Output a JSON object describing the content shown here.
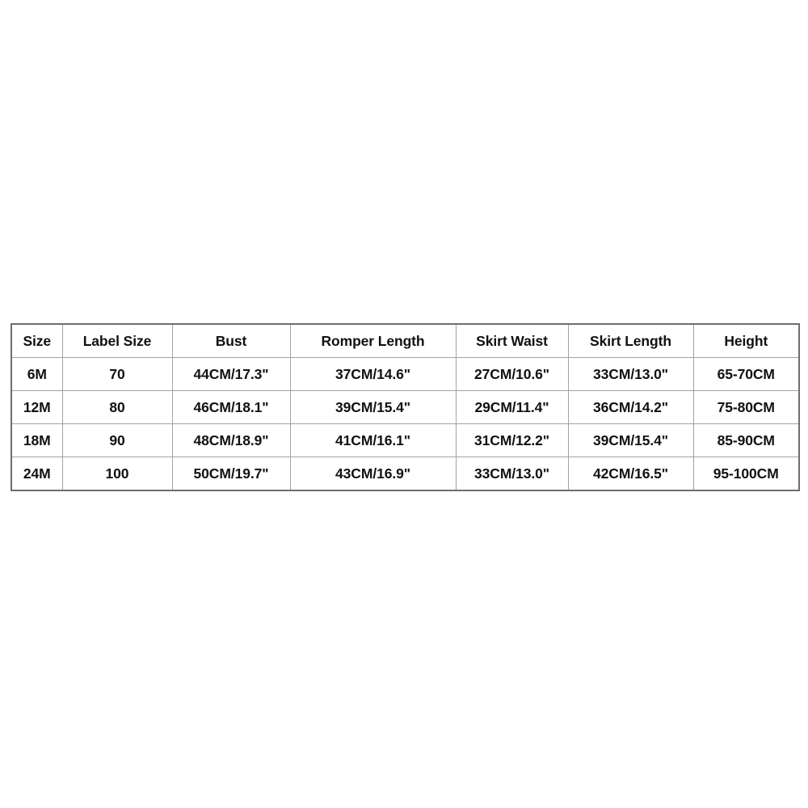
{
  "page": {
    "background_color": "#ffffff",
    "text_color": "#111111",
    "border_color": "#a2a2a2",
    "outer_border_color": "#6e6e6e"
  },
  "chart_data": {
    "type": "table",
    "title": "",
    "columns": [
      "Size",
      "Label Size",
      "Bust",
      "Romper Length",
      "Skirt Waist",
      "Skirt Length",
      "Height"
    ],
    "rows": [
      {
        "size": "6M",
        "label_size": "70",
        "bust": "44CM/17.3\"",
        "romper_length": "37CM/14.6\"",
        "skirt_waist": "27CM/10.6\"",
        "skirt_length": "33CM/13.0\"",
        "height": "65-70CM"
      },
      {
        "size": "12M",
        "label_size": "80",
        "bust": "46CM/18.1\"",
        "romper_length": "39CM/15.4\"",
        "skirt_waist": "29CM/11.4\"",
        "skirt_length": "36CM/14.2\"",
        "height": "75-80CM"
      },
      {
        "size": "18M",
        "label_size": "90",
        "bust": "48CM/18.9\"",
        "romper_length": "41CM/16.1\"",
        "skirt_waist": "31CM/12.2\"",
        "skirt_length": "39CM/15.4\"",
        "height": "85-90CM"
      },
      {
        "size": "24M",
        "label_size": "100",
        "bust": "50CM/19.7\"",
        "romper_length": "43CM/16.9\"",
        "skirt_waist": "33CM/13.0\"",
        "skirt_length": "42CM/16.5\"",
        "height": "95-100CM"
      }
    ]
  }
}
